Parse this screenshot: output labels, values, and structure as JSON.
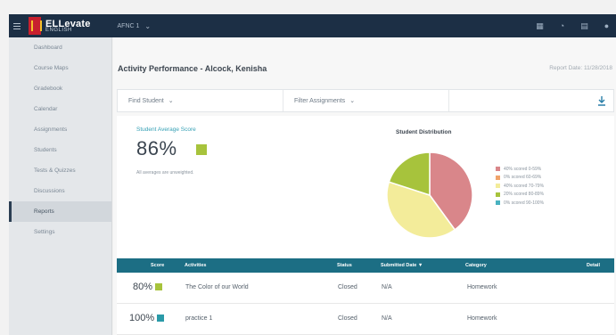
{
  "topbar": {
    "brand": "ELLevate",
    "brand_sub": "ENGLISH",
    "course": "AFNC 1",
    "icons": [
      "grid-icon",
      "bell-icon",
      "calendar-icon",
      "user-icon"
    ]
  },
  "sidebar": {
    "items": [
      {
        "label": "Dashboard",
        "active": false
      },
      {
        "label": "Course Maps",
        "active": false
      },
      {
        "label": "Gradebook",
        "active": false
      },
      {
        "label": "Calendar",
        "active": false
      },
      {
        "label": "Assignments",
        "active": false
      },
      {
        "label": "Students",
        "active": false
      },
      {
        "label": "Tests & Quizzes",
        "active": false
      },
      {
        "label": "Discussions",
        "active": false
      },
      {
        "label": "Reports",
        "active": true
      },
      {
        "label": "Settings",
        "active": false
      }
    ]
  },
  "main": {
    "title": "Activity Performance - Alcock, Kenisha",
    "report_date": "Report Date: 11/28/2018",
    "filters": {
      "student": "Find Student",
      "assignments": "Filter Assignments"
    },
    "score": {
      "label": "Student Average Score",
      "value": "86%",
      "note": "All averages are unweighted.",
      "color": "#a7c33c"
    },
    "distribution": {
      "title": "Student Distribution",
      "slices": [
        {
          "label": "40% scored 0-59%",
          "pct": 40,
          "color": "#d9868a"
        },
        {
          "label": "0% scored 60-69%",
          "pct": 0,
          "color": "#f0a36a"
        },
        {
          "label": "40% scored 70-79%",
          "pct": 40,
          "color": "#f3ec9a"
        },
        {
          "label": "20% scored 80-89%",
          "pct": 20,
          "color": "#a7c33c"
        },
        {
          "label": "0% scored 90-100%",
          "pct": 0,
          "color": "#49b2c0"
        }
      ]
    },
    "table": {
      "headers": [
        "Score",
        "Activities",
        "Status",
        "Submitted Date ▼",
        "Category",
        "Detail"
      ],
      "rows": [
        {
          "score": "80%",
          "activity": "The Color of our World",
          "status": "Closed",
          "submitted": "N/A",
          "category": "Homework",
          "color": "#a7c33c"
        },
        {
          "score": "100%",
          "activity": "practice 1",
          "status": "Closed",
          "submitted": "N/A",
          "category": "Homework",
          "color": "#2a9aa8"
        }
      ]
    }
  }
}
